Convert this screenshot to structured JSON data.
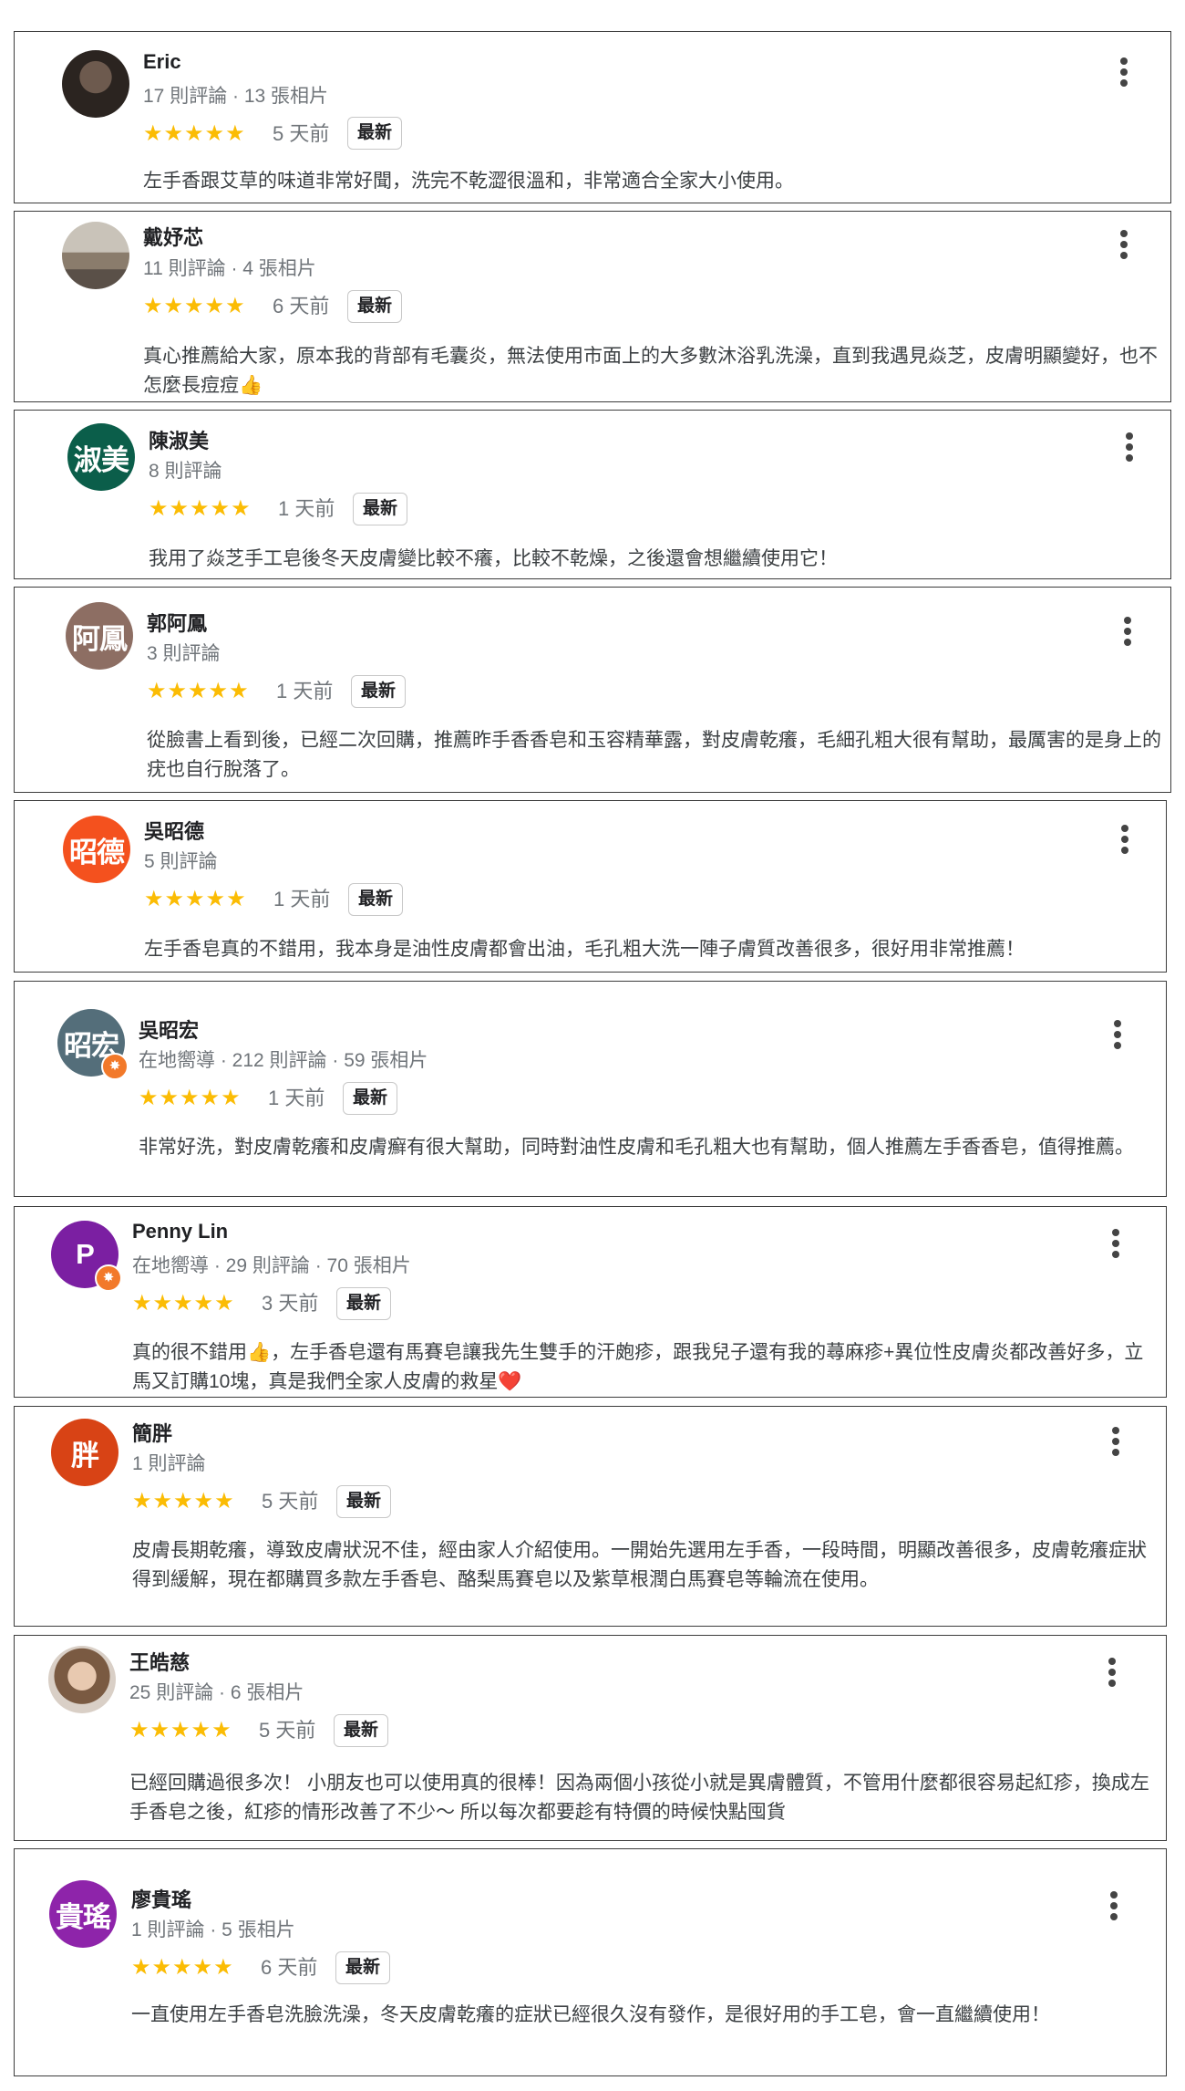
{
  "reviews": [
    {
      "name": "Eric",
      "meta": "17 則評論 · 13 張相片",
      "stars": "★★★★★",
      "time": "5 天前",
      "tag": "最新",
      "avatar_text": "",
      "avatar_color": "",
      "text": "左手香跟艾草的味道非常好聞，洗完不乾澀很溫和，非常適合全家大小使用。"
    },
    {
      "name": "戴妤芯",
      "meta": "11 則評論 · 4 張相片",
      "stars": "★★★★★",
      "time": "6 天前",
      "tag": "最新",
      "avatar_text": "",
      "avatar_color": "",
      "text": "真心推薦給大家，原本我的背部有毛囊炎，無法使用市面上的大多數沐浴乳洗澡，直到我遇見焱芝，皮膚明顯變好，也不怎麼長痘痘👍"
    },
    {
      "name": "陳淑美",
      "meta": "8 則評論",
      "stars": "★★★★★",
      "time": "1 天前",
      "tag": "最新",
      "avatar_text": "淑美",
      "avatar_color": "#0b5e4a",
      "text": "我用了焱芝手工皂後冬天皮膚變比較不癢，比較不乾燥，之後還會想繼續使用它！"
    },
    {
      "name": "郭阿鳳",
      "meta": "3 則評論",
      "stars": "★★★★★",
      "time": "1 天前",
      "tag": "最新",
      "avatar_text": "阿鳳",
      "avatar_color": "#8d6e63",
      "text": "從臉書上看到後，已經二次回購，推薦昨手香香皂和玉容精華露，對皮膚乾癢，毛細孔粗大很有幫助，最厲害的是身上的疣也自行脫落了。"
    },
    {
      "name": "吳昭德",
      "meta": "5 則評論",
      "stars": "★★★★★",
      "time": "1 天前",
      "tag": "最新",
      "avatar_text": "昭德",
      "avatar_color": "#f4511e",
      "text": "左手香皂真的不錯用，我本身是油性皮膚都會出油，毛孔粗大洗一陣子膚質改善很多，很好用非常推薦！"
    },
    {
      "name": "吳昭宏",
      "meta": "在地嚮導 · 212 則評論 · 59 張相片",
      "stars": "★★★★★",
      "time": "1 天前",
      "tag": "最新",
      "avatar_text": "昭宏",
      "avatar_color": "#546e7a",
      "text": "非常好洗，對皮膚乾癢和皮膚癬有很大幫助，同時對油性皮膚和毛孔粗大也有幫助，個人推薦左手香香皂，值得推薦。"
    },
    {
      "name": "Penny Lin",
      "meta": "在地嚮導 · 29 則評論 · 70 張相片",
      "stars": "★★★★★",
      "time": "3 天前",
      "tag": "最新",
      "avatar_text": "P",
      "avatar_color": "#7b1fa2",
      "text": "真的很不錯用👍，左手香皂還有馬賽皂讓我先生雙手的汗皰疹，跟我兒子還有我的蕁麻疹+異位性皮膚炎都改善好多，立馬又訂購10塊，真是我們全家人皮膚的救星❤️"
    },
    {
      "name": "簡胖",
      "meta": "1 則評論",
      "stars": "★★★★★",
      "time": "5 天前",
      "tag": "最新",
      "avatar_text": "胖",
      "avatar_color": "#d84315",
      "text": "皮膚長期乾癢，導致皮膚狀況不佳，經由家人介紹使用。一開始先選用左手香，一段時間，明顯改善很多，皮膚乾癢症狀得到緩解，現在都購買多款左手香皂、酪梨馬賽皂以及紫草根潤白馬賽皂等輪流在使用。"
    },
    {
      "name": "王皓慈",
      "meta": "25 則評論 · 6 張相片",
      "stars": "★★★★★",
      "time": "5 天前",
      "tag": "最新",
      "avatar_text": "",
      "avatar_color": "",
      "text": "已經回購過很多次！ 小朋友也可以使用真的很棒！因為兩個小孩從小就是異膚體質，不管用什麼都很容易起紅疹，換成左手香皂之後，紅疹的情形改善了不少～ 所以每次都要趁有特價的時候快點囤貨"
    },
    {
      "name": "廖貴瑤",
      "meta": "1 則評論 · 5 張相片",
      "stars": "★★★★★",
      "time": "6 天前",
      "tag": "最新",
      "avatar_text": "貴瑤",
      "avatar_color": "#8e24aa",
      "text": "一直使用左手香皂洗臉洗澡，冬天皮膚乾癢的症狀已經很久沒有發作，是很好用的手工皂，會一直繼續使用！"
    }
  ]
}
